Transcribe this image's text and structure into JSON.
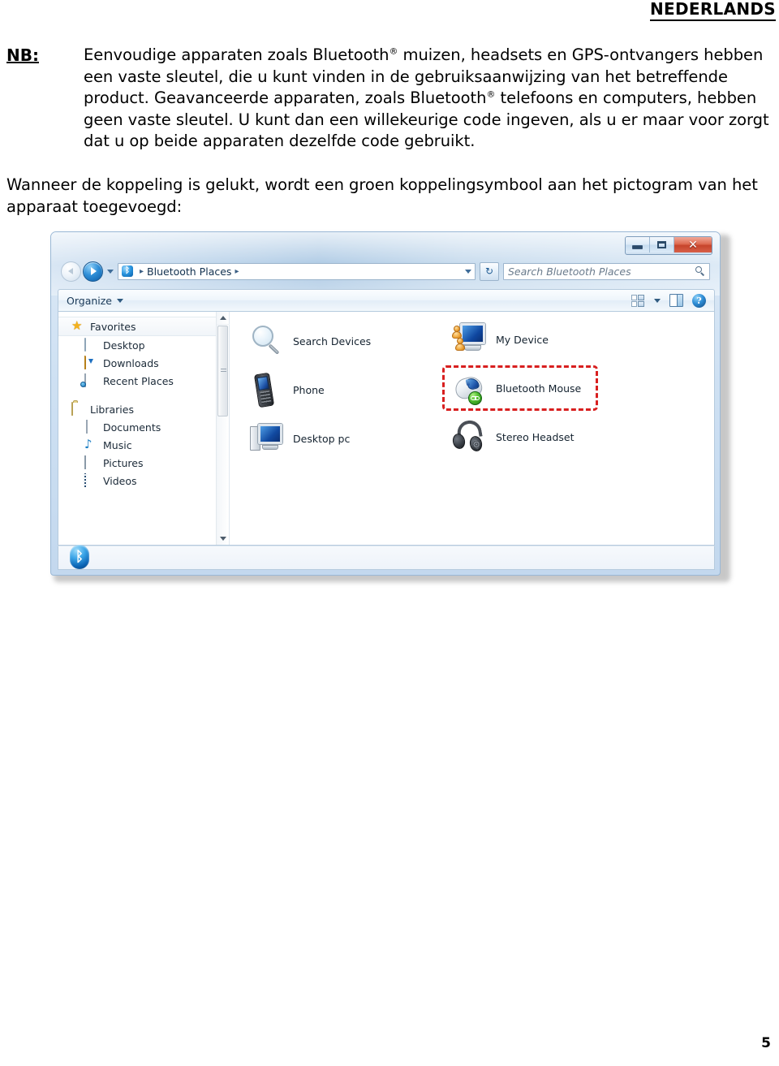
{
  "document": {
    "language_header": "NEDERLANDS",
    "page_number": "5",
    "note": {
      "label": "NB:",
      "text_part1": "Eenvoudige apparaten zoals Bluetooth",
      "sup1": "®",
      "text_part2": " muizen, headsets en GPS-ontvangers hebben een vaste sleutel, die u kunt vinden in de gebruiksaanwijzing van het betreffende product. Geavanceerde apparaten, zoals Bluetooth",
      "sup2": "®",
      "text_part3": " telefoons en computers, hebben geen vaste sleutel. U kunt dan een willekeurige code ingeven, als u er maar voor zorgt dat u op beide apparaten dezelfde code gebruikt."
    },
    "paragraph": "Wanneer de koppeling is gelukt, wordt een groen koppelingsymbool aan het pictogram van het apparaat toegevoegd:"
  },
  "explorer": {
    "titlebar": {
      "minimize_label": "",
      "maximize_label": "",
      "close_label": "✕"
    },
    "addressbar": {
      "breadcrumb_root": "Bluetooth Places",
      "separator": "▸",
      "refresh_label": "↻"
    },
    "search": {
      "placeholder": "Search Bluetooth Places"
    },
    "commandbar": {
      "organize_label": "Organize"
    },
    "navpane": {
      "groups": [
        {
          "label": "Favorites",
          "icon": "star-icon",
          "items": [
            {
              "label": "Desktop",
              "icon": "monitor-icon"
            },
            {
              "label": "Downloads",
              "icon": "download-folder-icon"
            },
            {
              "label": "Recent Places",
              "icon": "recent-places-icon"
            }
          ]
        },
        {
          "label": "Libraries",
          "icon": "library-folder-icon",
          "items": [
            {
              "label": "Documents",
              "icon": "document-icon"
            },
            {
              "label": "Music",
              "icon": "music-note-icon"
            },
            {
              "label": "Pictures",
              "icon": "picture-icon"
            },
            {
              "label": "Videos",
              "icon": "video-film-icon"
            }
          ]
        }
      ]
    },
    "content": {
      "column_left": [
        {
          "label": "Search Devices",
          "icon": "magnifier-icon"
        },
        {
          "label": "Phone",
          "icon": "mobile-phone-icon"
        },
        {
          "label": "Desktop pc",
          "icon": "desktop-pc-icon"
        }
      ],
      "column_right": [
        {
          "label": "My Device",
          "icon": "my-device-icon",
          "highlighted": false
        },
        {
          "label": "Bluetooth Mouse",
          "icon": "bluetooth-mouse-icon",
          "highlighted": true,
          "badge": "green-link-badge"
        },
        {
          "label": "Stereo Headset",
          "icon": "stereo-headset-icon",
          "highlighted": false
        }
      ]
    },
    "statusbar": {
      "logo": "bluetooth-logo",
      "glyph": "ᛒ"
    },
    "colors": {
      "highlight_red": "#d81f1f",
      "link_badge_green": "#3aa82a",
      "close_button_red": "#c6442b",
      "bluetooth_blue": "#0a63b4"
    }
  }
}
